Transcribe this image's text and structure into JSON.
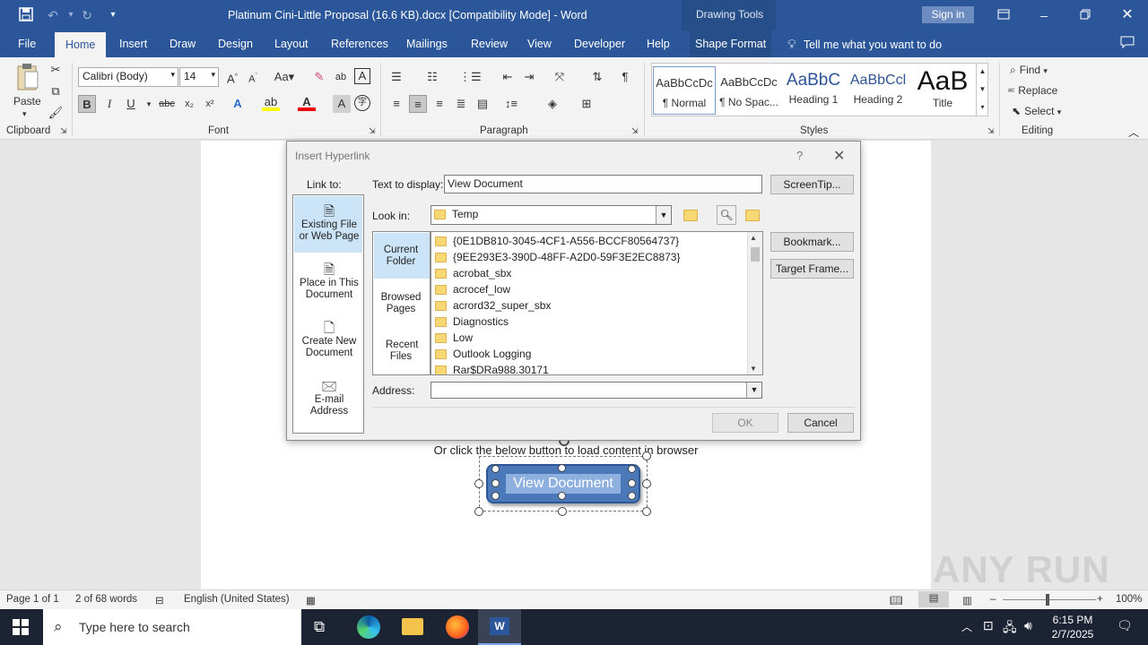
{
  "window": {
    "title": "Platinum Cini-Little Proposal (16.6 KB).docx [Compatibility Mode]  -  Word",
    "contextual_tab_group": "Drawing Tools",
    "sign_in": "Sign in"
  },
  "tabs": [
    "File",
    "Home",
    "Insert",
    "Draw",
    "Design",
    "Layout",
    "References",
    "Mailings",
    "Review",
    "View",
    "Developer",
    "Help",
    "Shape Format"
  ],
  "tell_me": "Tell me what you want to do",
  "ribbon": {
    "clipboard": {
      "paste": "Paste",
      "label": "Clipboard"
    },
    "font": {
      "name": "Calibri (Body)",
      "size": "14",
      "label": "Font"
    },
    "paragraph": {
      "label": "Paragraph"
    },
    "styles": {
      "label": "Styles",
      "items": [
        {
          "preview": "AaBbCcDc",
          "name": "¶ Normal"
        },
        {
          "preview": "AaBbCcDc",
          "name": "¶ No Spac..."
        },
        {
          "preview": "AaBbC",
          "name": "Heading 1"
        },
        {
          "preview": "AaBbCcl",
          "name": "Heading 2"
        },
        {
          "preview": "AaB",
          "name": "Title"
        }
      ]
    },
    "editing": {
      "find": "Find",
      "replace": "Replace",
      "select": "Select",
      "label": "Editing"
    }
  },
  "document": {
    "body_text": "Or click the below button to load content in browser",
    "button_text": "View Document"
  },
  "dialog": {
    "title": "Insert Hyperlink",
    "help": "?",
    "link_to_label": "Link to:",
    "link_options": [
      "Existing File or Web Page",
      "Place in This Document",
      "Create New Document",
      "E-mail Address"
    ],
    "text_to_display_label": "Text to display:",
    "text_to_display_value": "View Document",
    "screentip": "ScreenTip...",
    "look_in_label": "Look in:",
    "look_in_value": "Temp",
    "side_options": [
      "Current Folder",
      "Browsed Pages",
      "Recent Files"
    ],
    "files": [
      "{0E1DB810-3045-4CF1-A556-BCCF80564737}",
      "{9EE293E3-390D-48FF-A2D0-59F3E2EC8873}",
      "acrobat_sbx",
      "acrocef_low",
      "acrord32_super_sbx",
      "Diagnostics",
      "Low",
      "Outlook Logging",
      "Rar$DRa988.30171"
    ],
    "bookmark": "Bookmark...",
    "target_frame": "Target Frame...",
    "address_label": "Address:",
    "address_value": "",
    "ok": "OK",
    "cancel": "Cancel"
  },
  "status": {
    "page": "Page 1 of 1",
    "words": "2 of 68 words",
    "language": "English (United States)",
    "zoom": "100%"
  },
  "taskbar": {
    "search_placeholder": "Type here to search",
    "time": "6:15 PM",
    "date": "2/7/2025"
  },
  "watermark": "ANY RUN",
  "colors": {
    "word_blue": "#2b579a",
    "selection_blue": "#cce4f7",
    "shape_fill": "#4a78b8"
  }
}
